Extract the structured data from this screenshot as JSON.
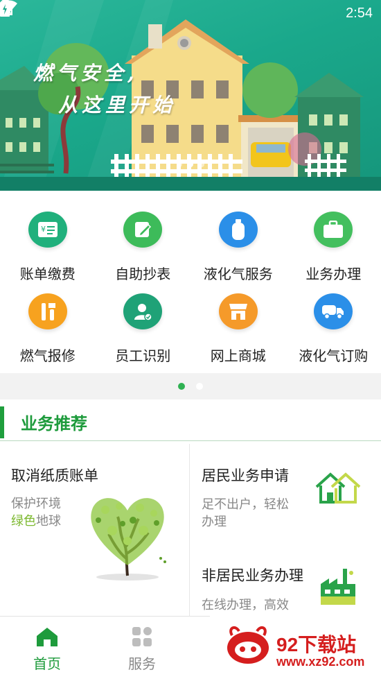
{
  "status_bar": {
    "time": "2:54"
  },
  "banner": {
    "slogan_line1": "燃气安全,",
    "slogan_line2": "从这里开始"
  },
  "grid": {
    "items": [
      {
        "label": "账单缴费",
        "icon": "bill-icon",
        "color": "#20b07c"
      },
      {
        "label": "自助抄表",
        "icon": "edit-icon",
        "color": "#3dbb5a"
      },
      {
        "label": "液化气服务",
        "icon": "gas-cylinder-icon",
        "color": "#2b8fe8"
      },
      {
        "label": "业务办理",
        "icon": "briefcase-icon",
        "color": "#43bf5e"
      },
      {
        "label": "燃气报修",
        "icon": "repair-icon",
        "color": "#f7a21f"
      },
      {
        "label": "员工识别",
        "icon": "employee-icon",
        "color": "#1fa277"
      },
      {
        "label": "网上商城",
        "icon": "shop-icon",
        "color": "#f59a2a"
      },
      {
        "label": "液化气订购",
        "icon": "truck-icon",
        "color": "#2b8fe8"
      }
    ]
  },
  "section": {
    "title": "业务推荐"
  },
  "cards": {
    "left": {
      "title": "取消纸质账单",
      "desc_line1": "保护环境",
      "desc_green": "绿色",
      "desc_rest": "地球"
    },
    "right_top": {
      "title": "居民业务申请",
      "desc_line1": "足不出户，轻松",
      "desc_line2": "办理"
    },
    "right_bottom": {
      "title": "非居民业务办理",
      "desc_line1": "在线办理，高效"
    }
  },
  "bottom_nav": {
    "home_label": "首页",
    "service_label": "服务"
  },
  "watermark": {
    "text": "92下载站",
    "url": "www.xz92.com"
  },
  "colors": {
    "brand_green": "#1e9b3c",
    "accent_lime": "#7cb82f",
    "banner_teal": "#1aa88b"
  }
}
